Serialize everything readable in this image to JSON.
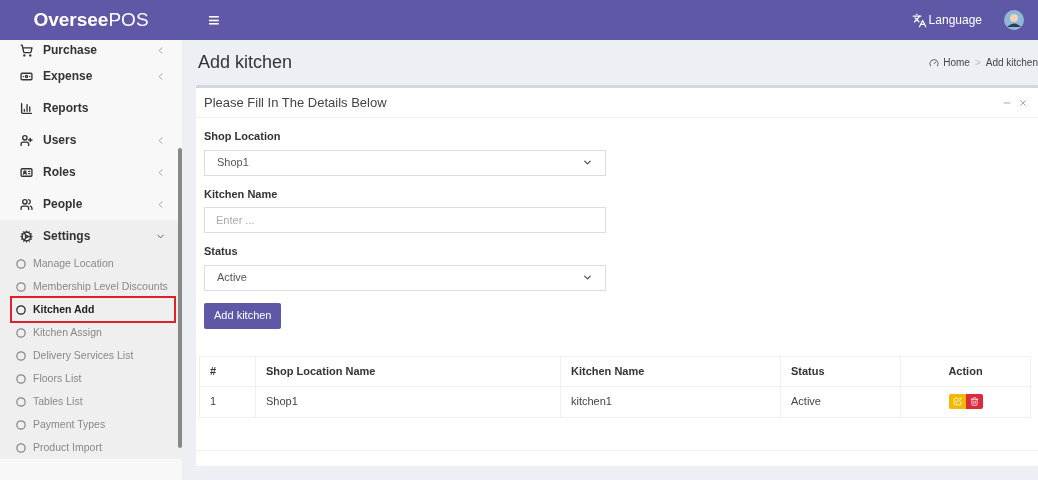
{
  "header": {
    "logo_bold": "Oversee",
    "logo_rest": "POS",
    "menu_toggle": "≡",
    "language": "Language"
  },
  "sidebar": {
    "items": [
      {
        "label": "Purchase",
        "kind": "group",
        "expanded": false
      },
      {
        "label": "Expense",
        "kind": "group",
        "expanded": false
      },
      {
        "label": "Reports",
        "kind": "link"
      },
      {
        "label": "Users",
        "kind": "group",
        "expanded": false
      },
      {
        "label": "Roles",
        "kind": "group",
        "expanded": false
      },
      {
        "label": "People",
        "kind": "group",
        "expanded": false
      },
      {
        "label": "Settings",
        "kind": "group",
        "expanded": true,
        "children": [
          {
            "label": "Manage Location",
            "selected": false
          },
          {
            "label": "Membership Level Discounts",
            "selected": false
          },
          {
            "label": "Kitchen Add",
            "selected": true
          },
          {
            "label": "Kitchen Assign",
            "selected": false
          },
          {
            "label": "Delivery Services List",
            "selected": false
          },
          {
            "label": "Floors List",
            "selected": false
          },
          {
            "label": "Tables List",
            "selected": false
          },
          {
            "label": "Payment Types",
            "selected": false
          },
          {
            "label": "Product Import",
            "selected": false
          }
        ]
      }
    ]
  },
  "page": {
    "title": "Add kitchen",
    "breadcrumb": [
      "Home",
      ">",
      "Add kitchen"
    ]
  },
  "card": {
    "title": "Please Fill In The Details Below",
    "form": [
      {
        "label": "Shop Location",
        "kind": "select",
        "value": "Shop1"
      },
      {
        "label": "Kitchen Name",
        "kind": "input",
        "placeholder": "Enter ..."
      },
      {
        "label": "Status",
        "kind": "select",
        "value": "Active"
      }
    ],
    "submit": "Add kitchen",
    "table": {
      "columns": [
        "#",
        "Shop Location Name",
        "Kitchen Name",
        "Status",
        "Action"
      ],
      "rows": [
        {
          "cells": [
            "1",
            "Shop1",
            "kitchen1",
            "Active"
          ]
        }
      ]
    }
  }
}
